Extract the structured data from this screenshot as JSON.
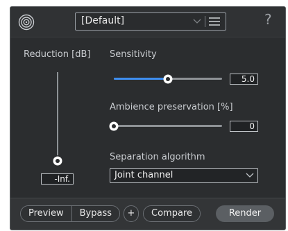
{
  "header": {
    "logo_icon": "concentric-circles-logo-icon",
    "preset_label": "[Default]",
    "preset_chevron_icon": "chevron-down-icon",
    "preset_menu_icon": "hamburger-menu-icon",
    "help_label": "?"
  },
  "controls": {
    "reduction": {
      "label": "Reduction [dB]",
      "value": "-Inf.",
      "level": 0
    },
    "sensitivity": {
      "label": "Sensitivity",
      "value": "5.0",
      "fraction": 0.5
    },
    "ambience": {
      "label": "Ambience preservation [%]",
      "value": "0",
      "fraction": 0
    },
    "algorithm": {
      "label": "Separation algorithm",
      "selected": "Joint channel",
      "chevron_icon": "chevron-down-icon"
    }
  },
  "footer": {
    "preview_label": "Preview",
    "bypass_label": "Bypass",
    "plus_label": "+",
    "compare_label": "Compare",
    "render_label": "Render"
  },
  "colors": {
    "accent": "#3e8ef0",
    "panel": "#2b2d2f",
    "render_button": "#5b5f63"
  }
}
